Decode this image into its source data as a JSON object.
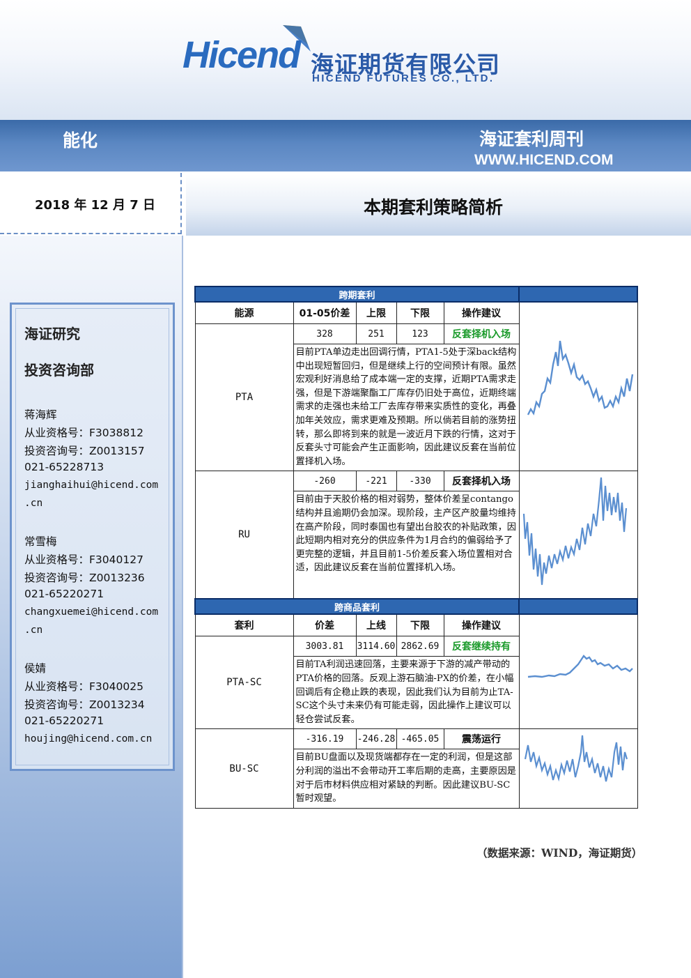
{
  "header": {
    "logo_text": "Hicend",
    "company_cn": "海证期货有限公司",
    "company_en": "HICEND  FUTURES  CO.,  LTD.",
    "sector": "能化",
    "publication": "海证套利周刊",
    "website": "WWW.HICEND.COM",
    "brand_color": "#2a6bbf",
    "band_color": "#4a7ab8"
  },
  "date": "2018 年 12 月 7 日",
  "page_title": "本期套利策略简析",
  "sidebar": {
    "dept_line1": "海证研究",
    "dept_line2": "投资咨询部",
    "analysts": [
      {
        "name": "蒋海辉",
        "qualification": "从业资格号：F3038812",
        "consult": "投资咨询号：Z0013157",
        "phone": "021-65228713",
        "email1": "jianghaihui@hicend.com",
        "email2": ".cn"
      },
      {
        "name": "常雪梅",
        "qualification": "从业资格号：F3040127",
        "consult": "投资咨询号：Z0013236",
        "phone": "021-65220271",
        "email1": "changxuemei@hicend.com",
        "email2": ".cn"
      },
      {
        "name": "侯婧",
        "qualification": "从业资格号：F3040025",
        "consult": "投资咨询号：Z0013234",
        "phone": "021-65220271",
        "email1": "houjing@hicend.com.cn",
        "email2": ""
      }
    ]
  },
  "intertemporal": {
    "section_title": "跨期套利",
    "headers": [
      "能源",
      "01-05价差",
      "上限",
      "下限",
      "操作建议"
    ],
    "rows": [
      {
        "name": "PTA",
        "spread": "328",
        "upper": "251",
        "lower": "123",
        "advice": "反套择机入场",
        "text": "目前PTA单边走出回调行情，PTA1-5处于深back结构中出现短暂回归，但是继续上行的空间预计有限。虽然宏观利好消息给了成本端一定的支撑，近期PTA需求走强，但是下游端聚酯工厂库存仍旧处于高位，近期终端需求的走强也未给工厂去库存带来实质性的变化，再叠加年关效应，需求更难及预期。所以倘若目前的涨势扭转，那么即将到来的就是一波近月下跌的行情，这对于反套头寸可能会产生正面影响，因此建议反套在当前位置择机入场。"
      },
      {
        "name": "RU",
        "spread": "-260",
        "upper": "-221",
        "lower": "-330",
        "advice": "反套择机入场",
        "text": "目前由于天胶价格的相对弱势，整体价差呈contango结构并且逾期仍会加深。现阶段，主产区产胶量均维持在高产阶段，同时泰国也有望出台胶农的补贴政策，因此短期内相对充分的供应条件为1月合约的偏弱给予了更完整的逻辑，并且目前1-5价差反套入场位置相对合适，因此建议反套在当前位置择机入场。"
      }
    ]
  },
  "intercommodity": {
    "section_title": "跨商品套利",
    "headers": [
      "套利",
      "价差",
      "上线",
      "下限",
      "操作建议"
    ],
    "rows": [
      {
        "name": "PTA-SC",
        "spread": "3003.81",
        "upper": "3114.60",
        "lower": "2862.69",
        "advice": "反套继续持有",
        "text": "目前TA利润迅速回落，主要来源于下游的减产带动的PTA价格的回落。反观上游石脑油-PX的价差，在小幅回调后有企稳止跌的表现，因此我们认为目前为止TA-SC这个头寸未来仍有可能走弱，因此操作上建议可以轻仓尝试反套。"
      },
      {
        "name": "BU-SC",
        "spread": "-316.19",
        "upper": "-246.28",
        "lower": "-465.05",
        "advice": "震荡运行",
        "text": "目前BU盘面以及现货端都存在一定的利润，但是这部分利润的溢出不会带动开工率后期的走高，主要原因是对于后市材料供应相对紧缺的判断。因此建议BU-SC暂时观望。"
      }
    ]
  },
  "source": "（数据来源：WIND，海证期货）",
  "colors": {
    "advice_green": "#1a9a2a",
    "section_blue": "#2e67b1",
    "spark_line": "#5b8fd0"
  }
}
